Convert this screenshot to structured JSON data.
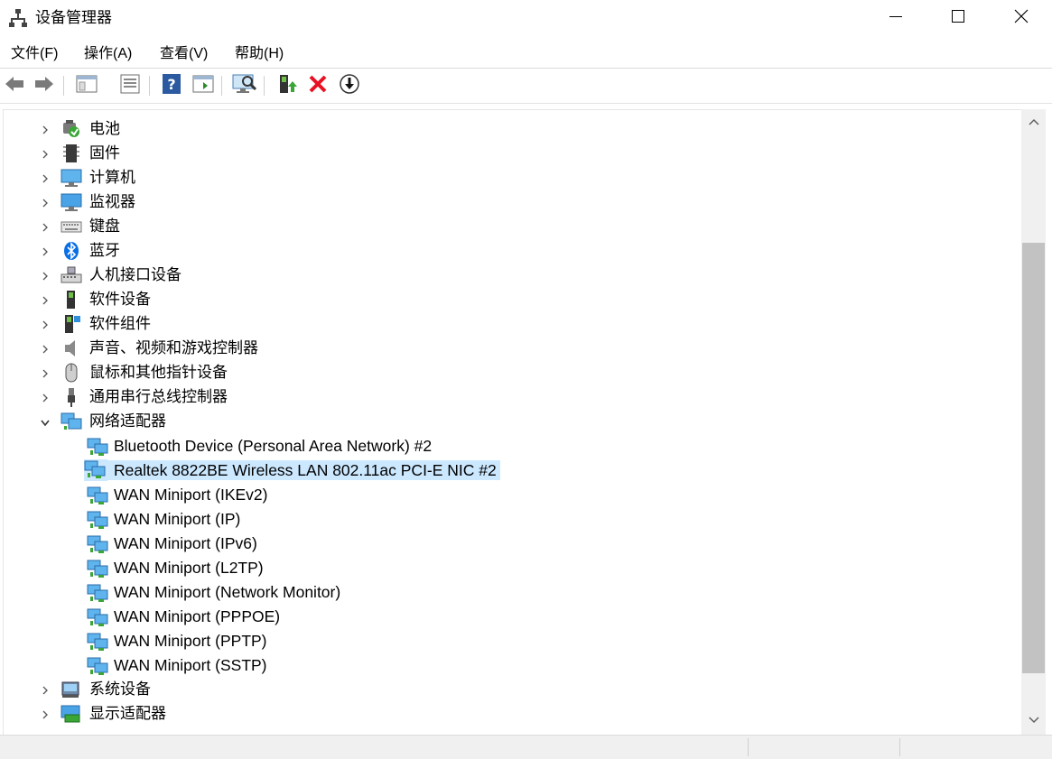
{
  "window": {
    "title": "设备管理器",
    "controls": [
      "minimize-icon",
      "maximize-icon",
      "close-icon"
    ]
  },
  "menu": [
    {
      "label": "文件(F)"
    },
    {
      "label": "操作(A)"
    },
    {
      "label": "查看(V)"
    },
    {
      "label": "帮助(H)"
    }
  ],
  "toolbar": {
    "buttons": [
      "back-icon",
      "forward-icon",
      "show-hide-tree-icon",
      "properties-icon",
      "help-icon",
      "action-pane-icon",
      "scan-hardware-icon",
      "update-driver-icon",
      "uninstall-icon",
      "disable-device-icon"
    ]
  },
  "tree": {
    "categories_top": [
      {
        "label": "电池",
        "icon": "battery-icon",
        "expanded": false
      },
      {
        "label": "固件",
        "icon": "firmware-chip-icon",
        "expanded": false
      },
      {
        "label": "计算机",
        "icon": "computer-icon",
        "expanded": false
      },
      {
        "label": "监视器",
        "icon": "monitor-icon",
        "expanded": false
      },
      {
        "label": "键盘",
        "icon": "keyboard-icon",
        "expanded": false
      },
      {
        "label": "蓝牙",
        "icon": "bluetooth-icon",
        "expanded": false
      },
      {
        "label": "人机接口设备",
        "icon": "hid-icon",
        "expanded": false
      },
      {
        "label": "软件设备",
        "icon": "software-device-icon",
        "expanded": false
      },
      {
        "label": "软件组件",
        "icon": "software-component-icon",
        "expanded": false
      },
      {
        "label": "声音、视频和游戏控制器",
        "icon": "speaker-icon",
        "expanded": false
      },
      {
        "label": "鼠标和其他指针设备",
        "icon": "mouse-icon",
        "expanded": false
      },
      {
        "label": "通用串行总线控制器",
        "icon": "usb-icon",
        "expanded": false
      },
      {
        "label": "网络适配器",
        "icon": "network-adapter-icon",
        "expanded": true
      }
    ],
    "network_devices": [
      {
        "label": "Bluetooth Device (Personal Area Network) #2",
        "selected": false
      },
      {
        "label": "Realtek 8822BE Wireless LAN 802.11ac PCI-E NIC #2",
        "selected": true
      },
      {
        "label": "WAN Miniport (IKEv2)",
        "selected": false
      },
      {
        "label": "WAN Miniport (IP)",
        "selected": false
      },
      {
        "label": "WAN Miniport (IPv6)",
        "selected": false
      },
      {
        "label": "WAN Miniport (L2TP)",
        "selected": false
      },
      {
        "label": "WAN Miniport (Network Monitor)",
        "selected": false
      },
      {
        "label": "WAN Miniport (PPPOE)",
        "selected": false
      },
      {
        "label": "WAN Miniport (PPTP)",
        "selected": false
      },
      {
        "label": "WAN Miniport (SSTP)",
        "selected": false
      }
    ],
    "categories_bottom": [
      {
        "label": "系统设备",
        "icon": "system-device-icon",
        "expanded": false
      },
      {
        "label": "显示适配器",
        "icon": "display-adapter-icon",
        "expanded": false
      }
    ]
  },
  "colors": {
    "selection": "#cce8ff",
    "network_icon": "#2f8fd8",
    "uninstall_red": "#e81123"
  }
}
